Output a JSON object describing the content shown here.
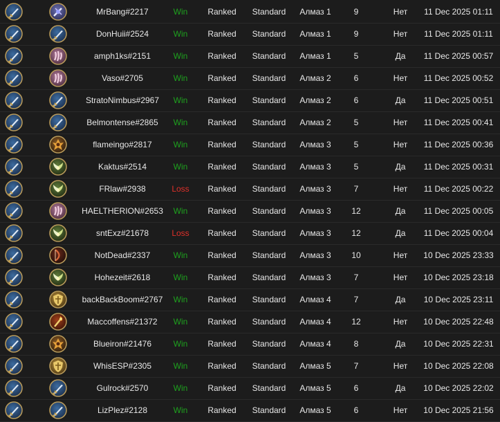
{
  "colors": {
    "win": "#1ea11e",
    "loss": "#e0302a",
    "text": "#e8e8e8",
    "background": "#1c1c1c"
  },
  "rows": [
    {
      "player": "MrBang#2217",
      "result": "Win",
      "mode": "Ranked",
      "format": "Standard",
      "rank": "Алмаз 1",
      "count": "9",
      "flag": "Нет",
      "date": "11 Dec 2025 01:11",
      "hero_icon": "purple-rune-icon"
    },
    {
      "player": "DonHuii#2524",
      "result": "Win",
      "mode": "Ranked",
      "format": "Standard",
      "rank": "Алмаз 1",
      "count": "9",
      "flag": "Нет",
      "date": "11 Dec 2025 01:11",
      "hero_icon": "blue-sword-icon"
    },
    {
      "player": "amph1ks#2151",
      "result": "Win",
      "mode": "Ranked",
      "format": "Standard",
      "rank": "Алмаз 1",
      "count": "5",
      "flag": "Да",
      "date": "11 Dec 2025 00:57",
      "hero_icon": "pink-claw-icon"
    },
    {
      "player": "Vaso#2705",
      "result": "Win",
      "mode": "Ranked",
      "format": "Standard",
      "rank": "Алмаз 2",
      "count": "6",
      "flag": "Нет",
      "date": "11 Dec 2025 00:52",
      "hero_icon": "pink-claw-icon"
    },
    {
      "player": "StratoNimbus#2967",
      "result": "Win",
      "mode": "Ranked",
      "format": "Standard",
      "rank": "Алмаз 2",
      "count": "6",
      "flag": "Да",
      "date": "11 Dec 2025 00:51",
      "hero_icon": "blue-sword-icon"
    },
    {
      "player": "Belmontense#2865",
      "result": "Win",
      "mode": "Ranked",
      "format": "Standard",
      "rank": "Алмаз 2",
      "count": "5",
      "flag": "Нет",
      "date": "11 Dec 2025 00:41",
      "hero_icon": "blue-sword-icon"
    },
    {
      "player": "flameingo#2817",
      "result": "Win",
      "mode": "Ranked",
      "format": "Standard",
      "rank": "Алмаз 3",
      "count": "5",
      "flag": "Нет",
      "date": "11 Dec 2025 00:36",
      "hero_icon": "flame-crest-icon"
    },
    {
      "player": "Kaktus#2514",
      "result": "Win",
      "mode": "Ranked",
      "format": "Standard",
      "rank": "Алмаз 3",
      "count": "5",
      "flag": "Да",
      "date": "11 Dec 2025 00:31",
      "hero_icon": "green-wings-icon"
    },
    {
      "player": "FRlaw#2938",
      "result": "Loss",
      "mode": "Ranked",
      "format": "Standard",
      "rank": "Алмаз 3",
      "count": "7",
      "flag": "Нет",
      "date": "11 Dec 2025 00:22",
      "hero_icon": "green-wings-icon"
    },
    {
      "player": "HAELTHERION#2653",
      "result": "Win",
      "mode": "Ranked",
      "format": "Standard",
      "rank": "Алмаз 3",
      "count": "12",
      "flag": "Да",
      "date": "11 Dec 2025 00:05",
      "hero_icon": "pink-claw-icon"
    },
    {
      "player": "sntExz#21678",
      "result": "Loss",
      "mode": "Ranked",
      "format": "Standard",
      "rank": "Алмаз 3",
      "count": "12",
      "flag": "Да",
      "date": "11 Dec 2025 00:04",
      "hero_icon": "green-wings-icon"
    },
    {
      "player": "NotDead#2337",
      "result": "Win",
      "mode": "Ranked",
      "format": "Standard",
      "rank": "Алмаз 3",
      "count": "10",
      "flag": "Нет",
      "date": "10 Dec 2025 23:33",
      "hero_icon": "red-bow-icon"
    },
    {
      "player": "Hohezeit#2618",
      "result": "Win",
      "mode": "Ranked",
      "format": "Standard",
      "rank": "Алмаз 3",
      "count": "7",
      "flag": "Нет",
      "date": "10 Dec 2025 23:18",
      "hero_icon": "green-wings-icon"
    },
    {
      "player": "backBackBoom#2767",
      "result": "Win",
      "mode": "Ranked",
      "format": "Standard",
      "rank": "Алмаз 4",
      "count": "7",
      "flag": "Да",
      "date": "10 Dec 2025 23:11",
      "hero_icon": "gold-shield-icon"
    },
    {
      "player": "Maccoffens#21372",
      "result": "Win",
      "mode": "Ranked",
      "format": "Standard",
      "rank": "Алмаз 4",
      "count": "12",
      "flag": "Нет",
      "date": "10 Dec 2025 22:48",
      "hero_icon": "fire-torch-icon"
    },
    {
      "player": "Blueiron#21476",
      "result": "Win",
      "mode": "Ranked",
      "format": "Standard",
      "rank": "Алмаз 4",
      "count": "8",
      "flag": "Да",
      "date": "10 Dec 2025 22:31",
      "hero_icon": "flame-crest-icon"
    },
    {
      "player": "WhisESP#2305",
      "result": "Win",
      "mode": "Ranked",
      "format": "Standard",
      "rank": "Алмаз 5",
      "count": "7",
      "flag": "Нет",
      "date": "10 Dec 2025 22:08",
      "hero_icon": "gold-shield-icon"
    },
    {
      "player": "Gulrock#2570",
      "result": "Win",
      "mode": "Ranked",
      "format": "Standard",
      "rank": "Алмаз 5",
      "count": "6",
      "flag": "Да",
      "date": "10 Dec 2025 22:02",
      "hero_icon": "blue-sword-icon"
    },
    {
      "player": "LizPlez#2128",
      "result": "Win",
      "mode": "Ranked",
      "format": "Standard",
      "rank": "Алмаз 5",
      "count": "6",
      "flag": "Нет",
      "date": "10 Dec 2025 21:56",
      "hero_icon": "blue-sword-icon"
    }
  ]
}
